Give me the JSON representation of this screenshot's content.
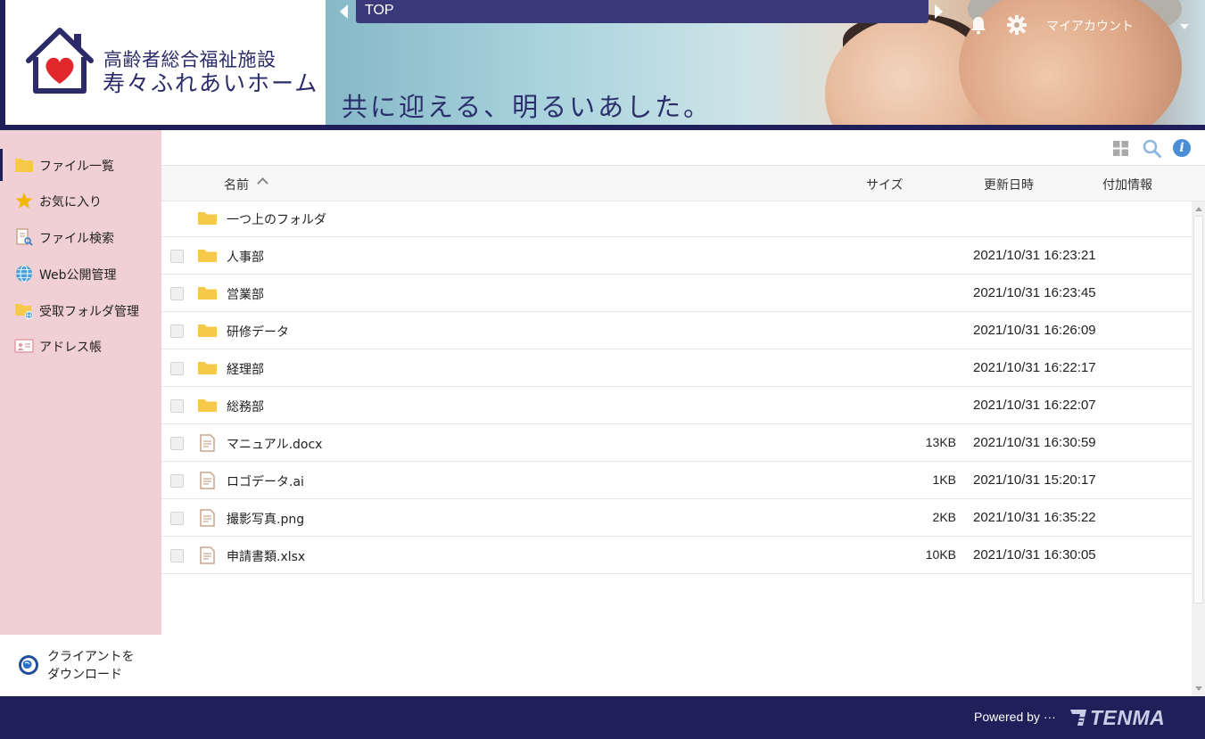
{
  "header": {
    "logo_subtitle": "高齢者総合福祉施設",
    "logo_title": "寿々ふれあいホーム",
    "tagline": "共に迎える、明るいあした。",
    "breadcrumb": "TOP",
    "account_label": "マイアカウント",
    "icons": [
      "bell-icon",
      "gear-icon",
      "chevron-down-icon"
    ]
  },
  "sidebar": {
    "items": [
      {
        "label": "ファイル一覧",
        "icon": "folder-icon",
        "active": true
      },
      {
        "label": "お気に入り",
        "icon": "star-icon",
        "active": false
      },
      {
        "label": "ファイル検索",
        "icon": "file-search-icon",
        "active": false
      },
      {
        "label": "Web公開管理",
        "icon": "globe-icon",
        "active": false
      },
      {
        "label": "受取フォルダ管理",
        "icon": "folder-globe-icon",
        "active": false
      },
      {
        "label": "アドレス帳",
        "icon": "address-card-icon",
        "active": false
      }
    ],
    "download": {
      "line1": "クライアントを",
      "line2": "ダウンロード"
    }
  },
  "main": {
    "toolbar_icons": [
      "grid-view-icon",
      "search-icon",
      "info-icon"
    ],
    "columns": {
      "name": "名前",
      "size": "サイズ",
      "modified": "更新日時",
      "extra": "付加情報"
    },
    "parent_folder": "一つ上のフォルダ",
    "rows": [
      {
        "type": "folder",
        "name": "人事部",
        "size": "",
        "modified": "2021/10/31 16:23:21"
      },
      {
        "type": "folder",
        "name": "営業部",
        "size": "",
        "modified": "2021/10/31 16:23:45"
      },
      {
        "type": "folder",
        "name": "研修データ",
        "size": "",
        "modified": "2021/10/31 16:26:09"
      },
      {
        "type": "folder",
        "name": "経理部",
        "size": "",
        "modified": "2021/10/31 16:22:17"
      },
      {
        "type": "folder",
        "name": "総務部",
        "size": "",
        "modified": "2021/10/31 16:22:07"
      },
      {
        "type": "file",
        "name": "マニュアル.docx",
        "size": "13KB",
        "modified": "2021/10/31 16:30:59"
      },
      {
        "type": "file",
        "name": "ロゴデータ.ai",
        "size": "1KB",
        "modified": "2021/10/31 15:20:17"
      },
      {
        "type": "file",
        "name": "撮影写真.png",
        "size": "2KB",
        "modified": "2021/10/31 16:35:22"
      },
      {
        "type": "file",
        "name": "申請書類.xlsx",
        "size": "10KB",
        "modified": "2021/10/31 16:30:05"
      }
    ]
  },
  "footer": {
    "powered_by": "Powered by ···",
    "brand": "TENMA"
  },
  "colors": {
    "navy": "#1f1f5a",
    "sidebar_bg": "#f0d0d4",
    "folder_yellow": "#f7c948",
    "info_blue": "#4a8fd6"
  }
}
